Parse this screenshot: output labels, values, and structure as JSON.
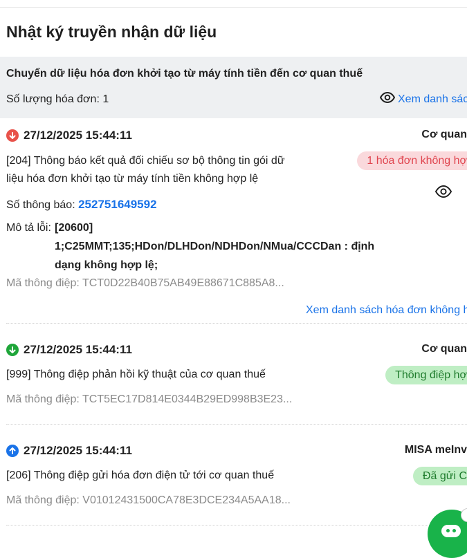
{
  "page_title": "Nhật ký truyền nhận dữ liệu",
  "summary": {
    "heading": "Chuyển dữ liệu hóa đơn khởi tạo từ máy tính tiền đến cơ quan thuế",
    "count_text": "Số lượng hóa đơn: 1",
    "view_link": "Xem danh sác"
  },
  "entries": [
    {
      "direction": "down-error",
      "time": "27/12/2025 15:44:11",
      "source": "Cơ quan",
      "message": "[204] Thông báo kết quả đối chiếu sơ bộ thông tin gói dữ liệu hóa đơn khởi tạo từ máy tính tiền không hợp lệ",
      "badge": "1 hóa đơn không hợ",
      "notice_label": "Số thông báo:",
      "notice_number": "252751649592",
      "error_label": "Mô tả lỗi:",
      "error_text": "[20600] 1;C25MMT;135;HDon/DLHDon/NDHDon/NMua/CCCDan : định dạng không hợp lệ;",
      "message_id": "Mã thông điệp: TCT0D22B40B75AB49E88671C885A8...",
      "list_link": "Xem danh sách hóa đơn không h"
    },
    {
      "direction": "down-ok",
      "time": "27/12/2025 15:44:11",
      "source": "Cơ quan",
      "message": "[999] Thông điệp phản hồi kỹ thuật của cơ quan thuế",
      "badge": "Thông điệp hợ",
      "message_id": "Mã thông điệp: TCT5EC17D814E0344B29ED998B3E23..."
    },
    {
      "direction": "up",
      "time": "27/12/2025 15:44:11",
      "source": "MISA meInv",
      "message": "[206] Thông điệp gửi hóa đơn điện tử tới cơ quan thuế",
      "badge": "Đã gửi C",
      "message_id": "Mã thông điệp: V01012431500CA78E3DCE234A5AA18..."
    }
  ],
  "colors": {
    "link": "#1a73e8",
    "error_icon": "#e8524a",
    "ok_icon": "#1fa63a",
    "up_icon": "#1a73e8",
    "badge_red_bg": "#fad9dc",
    "badge_green_bg": "#bfeec4",
    "chat_button": "#19b34a"
  }
}
